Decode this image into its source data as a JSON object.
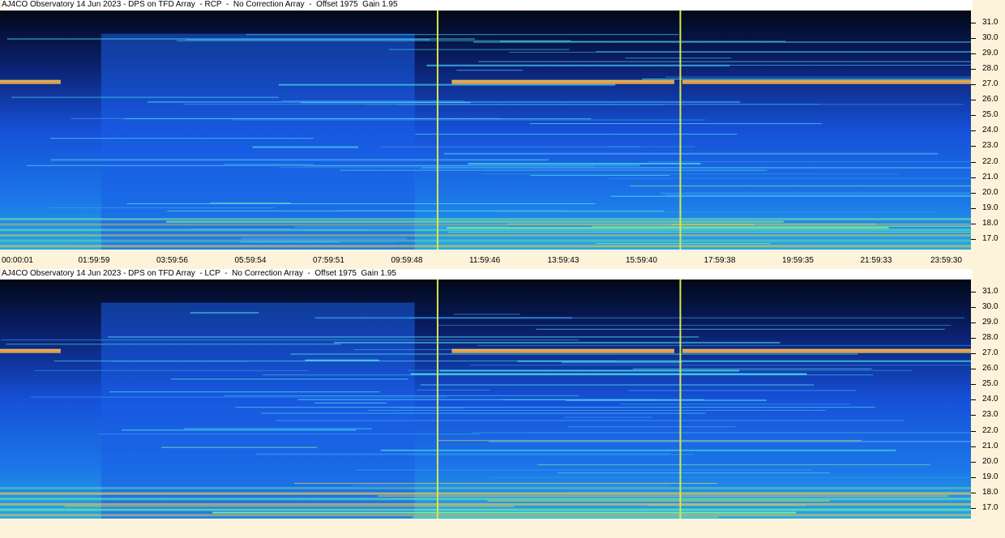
{
  "colors": {
    "background": "#0a1a3a",
    "axis_bg": "#fdf3da",
    "marker": "#d8e84a",
    "band_hot": "#ffd84a",
    "band_warm": "#4ad8c8"
  },
  "chart_data": [
    {
      "type": "heatmap",
      "title": "AJ4CO Observatory 14 Jun 2023 - DPS on TFD Array  - RCP  -  No Correction Array  -  Offset 1975  Gain 1.95",
      "x_tick_labels": [
        "00:00:01",
        "01:59:59",
        "03:59:56",
        "05:59:54",
        "07:59:51",
        "09:59:48",
        "11:59:46",
        "13:59:43",
        "15:59:40",
        "17:59:38",
        "19:59:35",
        "21:59:33",
        "23:59:30"
      ],
      "y_tick_labels": [
        "31.0",
        "30.0",
        "29.0",
        "28.0",
        "27.0",
        "26.0",
        "25.0",
        "24.0",
        "23.0",
        "22.0",
        "21.0",
        "20.0",
        "19.0",
        "18.0",
        "17.0"
      ],
      "y_range": [
        16.3,
        31.8
      ],
      "marker_times": [
        "10:49:00",
        "16:49:00"
      ]
    },
    {
      "type": "heatmap",
      "title": "AJ4CO Observatory 14 Jun 2023 - DPS on TFD Array  - LCP  -  No Correction Array  -  Offset 1975  Gain 1.95",
      "x_tick_labels": [],
      "y_tick_labels": [
        "31.0",
        "30.0",
        "29.0",
        "28.0",
        "27.0",
        "26.0",
        "25.0",
        "24.0",
        "23.0",
        "22.0",
        "21.0",
        "20.0",
        "19.0",
        "18.0",
        "17.0"
      ],
      "y_range": [
        16.3,
        31.8
      ],
      "marker_times": [
        "10:49:00",
        "16:49:00"
      ]
    }
  ]
}
